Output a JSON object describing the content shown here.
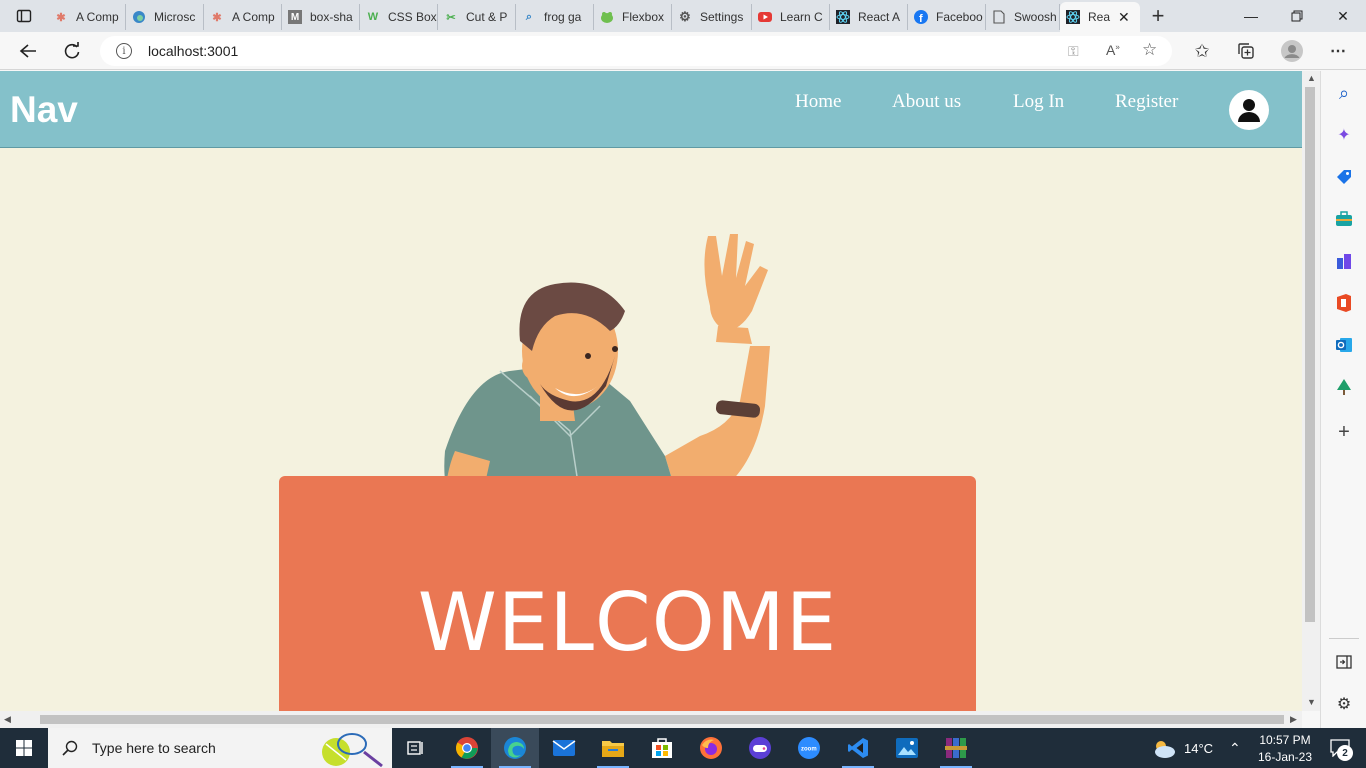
{
  "browser": {
    "tabs": [
      {
        "label": "A Comp",
        "icon": "asterisk-icon",
        "color": "#e07a6a"
      },
      {
        "label": "Microsc",
        "icon": "edge-icon",
        "color": "#3a88c8"
      },
      {
        "label": "A Comp",
        "icon": "asterisk-icon",
        "color": "#e07a6a"
      },
      {
        "label": "box-sha",
        "icon": "medium-icon",
        "color": "#666666"
      },
      {
        "label": "CSS Box",
        "icon": "w3schools-icon",
        "color": "#4caf50"
      },
      {
        "label": "Cut & P",
        "icon": "cut-paste-icon",
        "color": "#4caf50"
      },
      {
        "label": "frog ga",
        "icon": "search-icon",
        "color": "#3a88c8"
      },
      {
        "label": "Flexbox",
        "icon": "frog-icon",
        "color": "#6fbf4f"
      },
      {
        "label": "Settings",
        "icon": "gear-icon",
        "color": "#555555"
      },
      {
        "label": "Learn C",
        "icon": "youtube-icon",
        "color": "#e53935"
      },
      {
        "label": "React A",
        "icon": "react-icon",
        "color": "#61dafb"
      },
      {
        "label": "Faceboo",
        "icon": "facebook-icon",
        "color": "#1877f2"
      },
      {
        "label": "Swoosh",
        "icon": "page-icon",
        "color": "#555555"
      },
      {
        "label": "Rea",
        "icon": "react-icon",
        "color": "#61dafb",
        "active": true
      }
    ],
    "url": "localhost:3001"
  },
  "page": {
    "brand": "Nav",
    "nav_links": [
      "Home",
      "About us",
      "Log In",
      "Register"
    ],
    "welcome_text": "WELCOME",
    "colors": {
      "nav": "#84c1ca",
      "background": "#f4f2df",
      "sign": "#ea7753"
    }
  },
  "taskbar": {
    "search_placeholder": "Type here to search",
    "temperature": "14°C",
    "time": "10:57 PM",
    "date": "16-Jan-23",
    "notification_count": "2",
    "apps": [
      "task-view-icon",
      "chrome-icon",
      "edge-icon",
      "mail-icon",
      "file-explorer-icon",
      "store-icon",
      "firefox-icon",
      "game-icon",
      "zoom-icon",
      "vscode-icon",
      "photos-icon",
      "winrar-icon"
    ]
  }
}
